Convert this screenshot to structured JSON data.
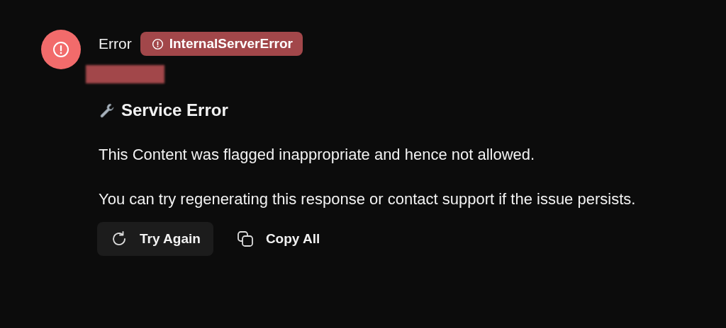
{
  "message": {
    "author": "Error",
    "badge": "InternalServerError",
    "heading": "Service Error",
    "paragraphs": [
      "This Content was flagged inappropriate and hence not allowed.",
      "You can try regenerating this response or contact support if the issue persists."
    ],
    "actions": [
      {
        "kind": "retry",
        "label": "Try Again",
        "hovered": true
      },
      {
        "kind": "copy",
        "label": "Copy All",
        "hovered": false
      }
    ]
  }
}
